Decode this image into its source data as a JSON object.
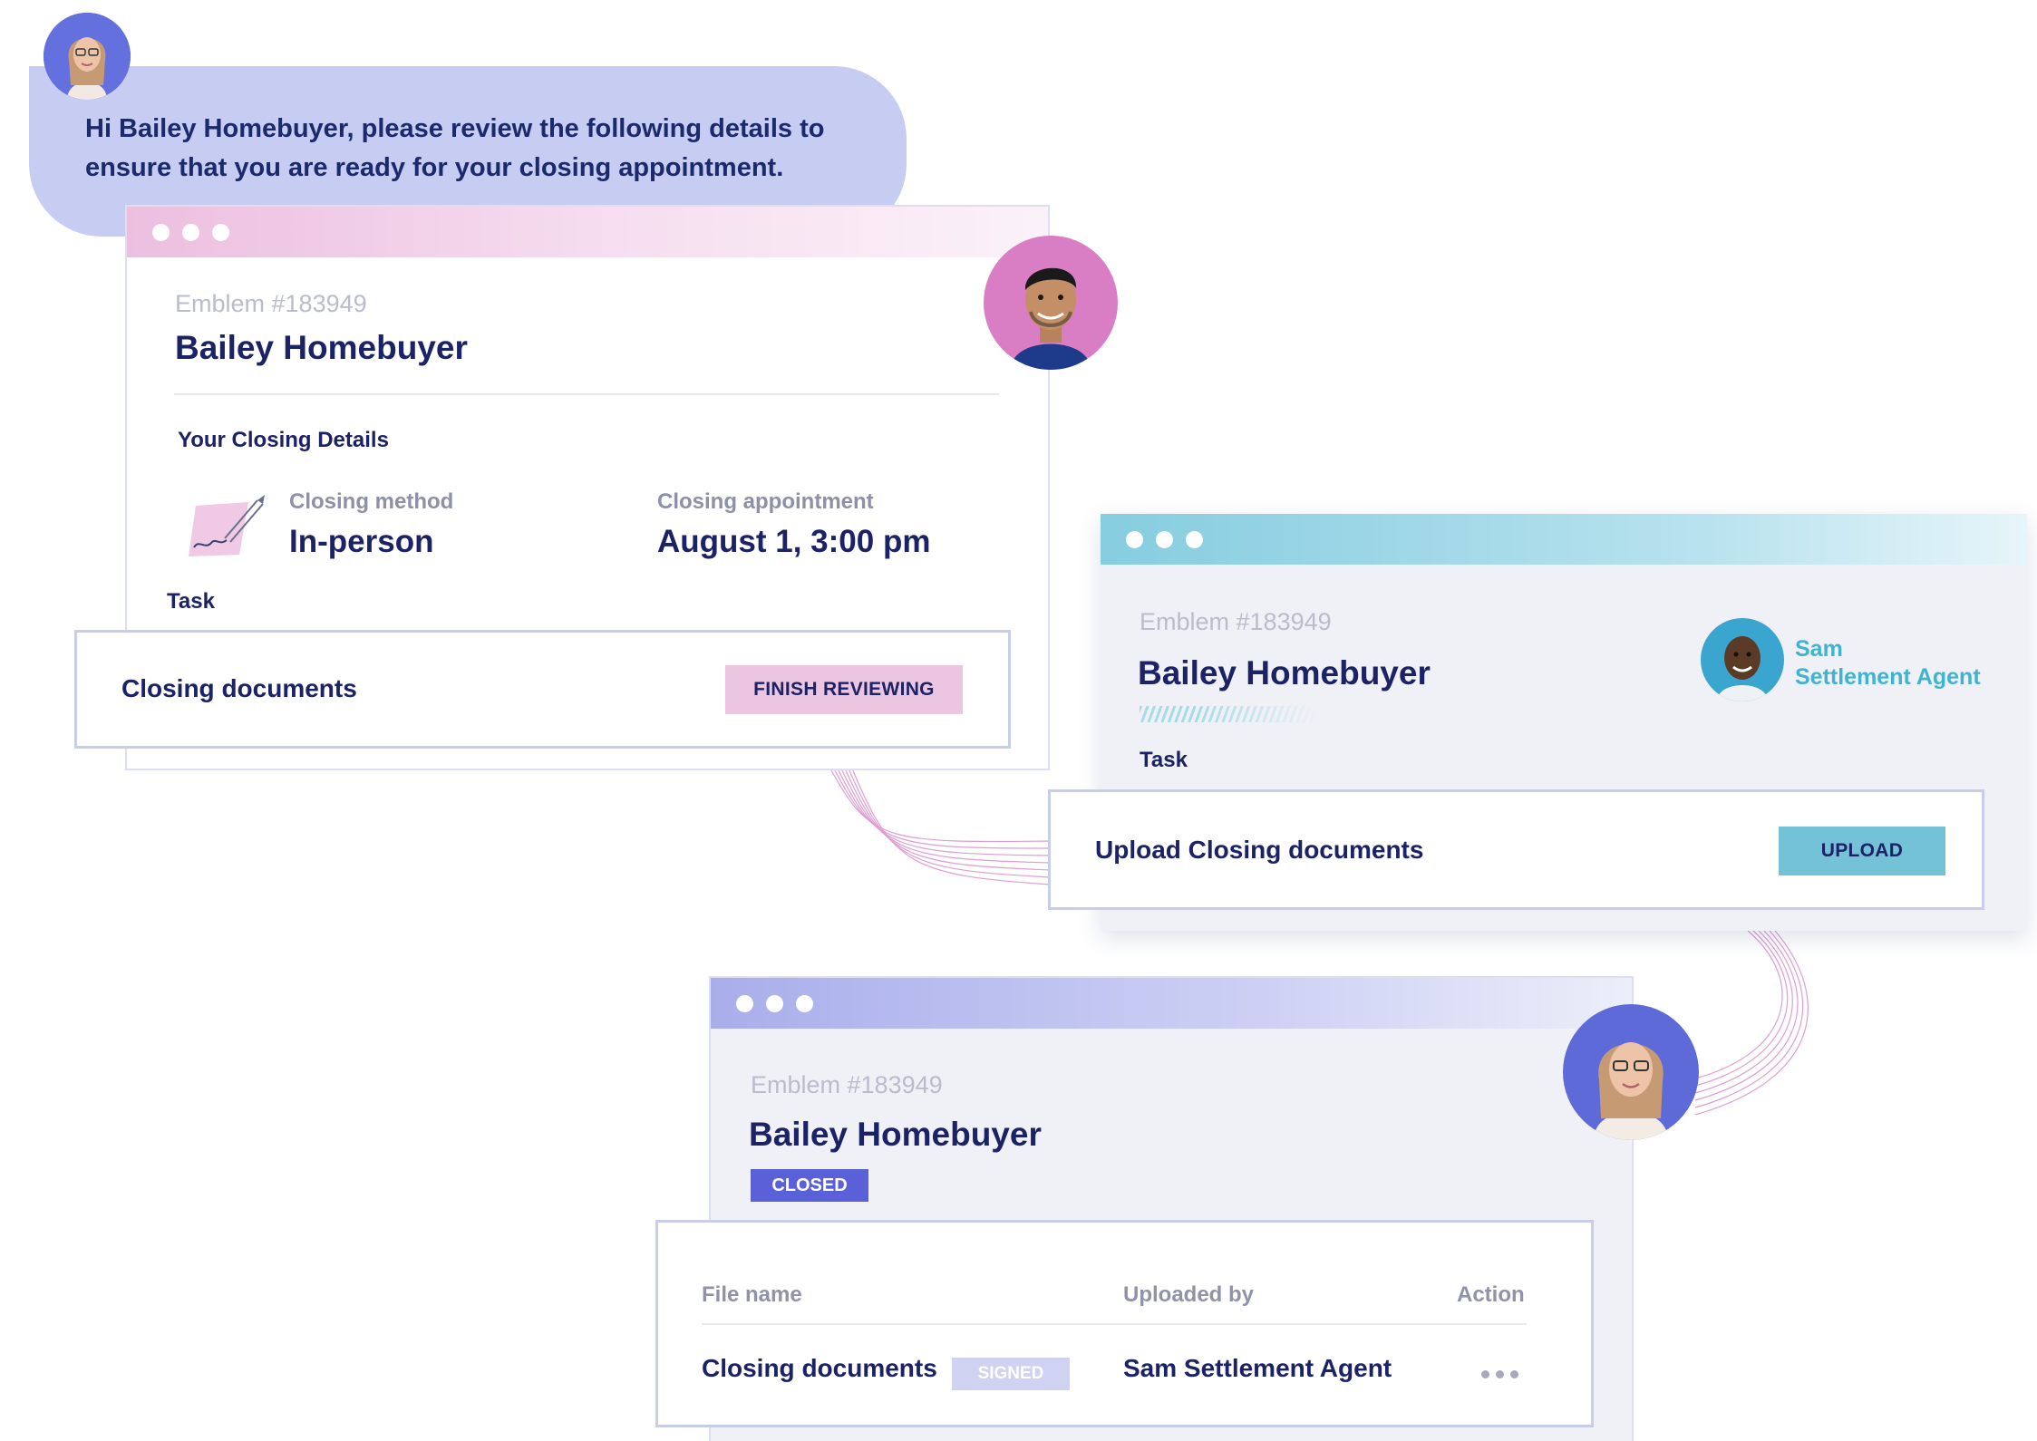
{
  "message": {
    "text": "Hi Bailey Homebuyer, please review the following details to ensure that you are ready for your closing appointment.",
    "bubble_color": "#c7ccf3"
  },
  "review_window": {
    "emblem": "Emblem #183949",
    "name": "Bailey Homebuyer",
    "section_title": "Your Closing Details",
    "closing_method_label": "Closing method",
    "closing_method_value": "In-person",
    "closing_appointment_label": "Closing appointment",
    "closing_appointment_value": "August 1, 3:00 pm",
    "task_label": "Task",
    "task": {
      "label": "Closing documents",
      "button": "FINISH REVIEWING"
    },
    "accent": "#ecbfdf"
  },
  "upload_window": {
    "emblem": "Emblem #183949",
    "name": "Bailey Homebuyer",
    "agent_first_name": "Sam",
    "agent_role": "Settlement Agent",
    "task_label": "Task",
    "task": {
      "label": "Upload Closing documents",
      "button": "UPLOAD"
    },
    "accent": "#86cde0"
  },
  "closed_window": {
    "emblem": "Emblem #183949",
    "name": "Bailey Homebuyer",
    "status": "CLOSED",
    "table": {
      "headers": [
        "File name",
        "Uploaded by",
        "Action"
      ],
      "rows": [
        {
          "file": "Closing documents",
          "badge": "SIGNED",
          "uploaded_by": "Sam Settlement Agent"
        }
      ]
    },
    "accent": "#5a61d8"
  },
  "icons": {
    "closing_method": "signature-pen-icon",
    "row_action": "more-options-icon"
  }
}
